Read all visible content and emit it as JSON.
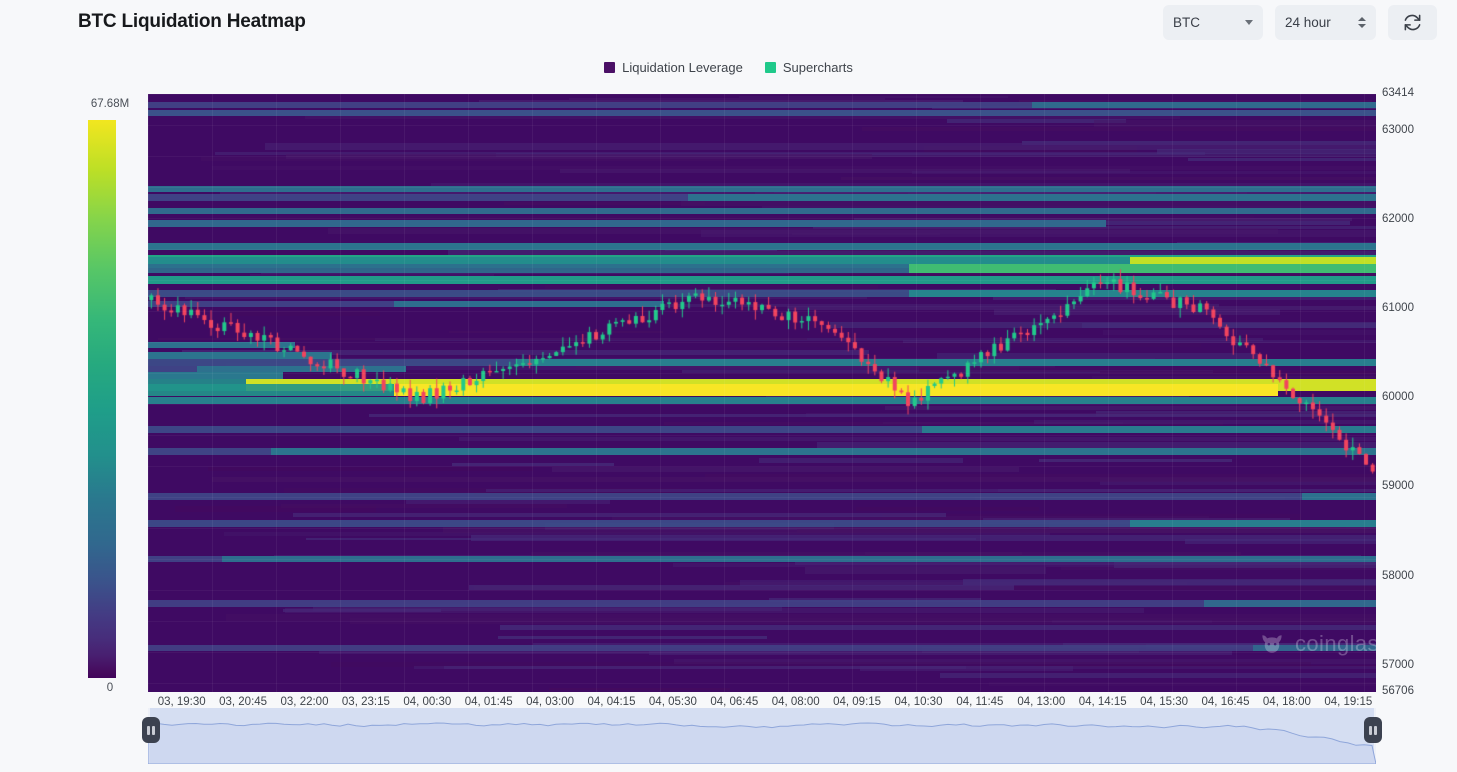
{
  "header": {
    "title": "BTC Liquidation Heatmap",
    "symbol_select": {
      "value": "BTC",
      "icon": "chevron-down-icon"
    },
    "range_stepper": {
      "value": "24 hour",
      "icon": "stepper-arrows-icon"
    },
    "refresh_button": {
      "icon": "refresh-icon",
      "label": ""
    }
  },
  "legend": [
    {
      "label": "Liquidation Leverage",
      "color": "#4b1066"
    },
    {
      "label": "Supercharts",
      "color": "#1fc98a"
    }
  ],
  "colorscale": {
    "max_label": "67.68M",
    "min_label": "0",
    "top_color": "#f2e61f",
    "bottom_color": "#42045b"
  },
  "watermark": {
    "text": "coinglass",
    "icon": "bull-logo-icon"
  },
  "brush": {
    "left_handle": "brush-handle-left",
    "right_handle": "brush-handle-right"
  },
  "chart_data": {
    "type": "heatmap",
    "title": "BTC Liquidation Heatmap",
    "xlabel": "",
    "ylabel": "",
    "grid": true,
    "legend_position": "top-center",
    "colorbar": {
      "label": "Liquidation Leverage",
      "min": 0,
      "max": 67680000,
      "min_label": "0",
      "max_label": "67.68M",
      "colormap": "viridis"
    },
    "ylim": [
      56706,
      63414
    ],
    "y_ticks": [
      63414,
      63000,
      62000,
      61000,
      60000,
      59000,
      58000,
      57000,
      56706
    ],
    "y_tick_labels": [
      "63414",
      "63000",
      "62000",
      "61000",
      "60000",
      "59000",
      "58000",
      "57000",
      "56706"
    ],
    "x_tick_labels": [
      "03, 19:30",
      "03, 20:45",
      "03, 22:00",
      "03, 23:15",
      "04, 00:30",
      "04, 01:45",
      "04, 03:00",
      "04, 04:15",
      "04, 05:30",
      "04, 06:45",
      "04, 08:00",
      "04, 09:15",
      "04, 10:30",
      "04, 11:45",
      "04, 13:00",
      "04, 14:15",
      "04, 15:30",
      "04, 16:45",
      "04, 18:00",
      "04, 19:15"
    ],
    "series": [
      {
        "name": "Liquidation Leverage",
        "type": "heatmap",
        "description": "Horizontal liquidation-level bands coloured by cumulative leverage magnitude (viridis: dark purple = low, yellow = high).",
        "bands": [
          {
            "price": 63290,
            "x_start": 0.72,
            "x_end": 1.0,
            "value": 14000000
          },
          {
            "price": 63200,
            "x_start": 0.0,
            "x_end": 1.0,
            "value": 6000000
          },
          {
            "price": 62350,
            "x_start": 0.0,
            "x_end": 1.0,
            "value": 15000000
          },
          {
            "price": 62250,
            "x_start": 0.44,
            "x_end": 1.0,
            "value": 16000000
          },
          {
            "price": 62100,
            "x_start": 0.0,
            "x_end": 1.0,
            "value": 14000000
          },
          {
            "price": 61960,
            "x_start": 0.0,
            "x_end": 0.78,
            "value": 13000000
          },
          {
            "price": 61700,
            "x_start": 0.0,
            "x_end": 1.0,
            "value": 17000000
          },
          {
            "price": 61560,
            "x_start": 0.0,
            "x_end": 1.0,
            "value": 34000000
          },
          {
            "price": 61520,
            "x_start": 0.8,
            "x_end": 1.0,
            "value": 60000000
          },
          {
            "price": 61460,
            "x_start": 0.62,
            "x_end": 1.0,
            "value": 42000000
          },
          {
            "price": 61330,
            "x_start": 0.0,
            "x_end": 1.0,
            "value": 30000000
          },
          {
            "price": 61180,
            "x_start": 0.62,
            "x_end": 1.0,
            "value": 22000000
          },
          {
            "price": 61060,
            "x_start": 0.2,
            "x_end": 0.42,
            "value": 15000000
          },
          {
            "price": 60600,
            "x_start": 0.0,
            "x_end": 0.12,
            "value": 16000000
          },
          {
            "price": 60480,
            "x_start": 0.0,
            "x_end": 0.15,
            "value": 17000000
          },
          {
            "price": 60400,
            "x_start": 0.3,
            "x_end": 1.0,
            "value": 20000000
          },
          {
            "price": 60330,
            "x_start": 0.04,
            "x_end": 0.21,
            "value": 16000000
          },
          {
            "price": 60260,
            "x_start": 0.0,
            "x_end": 0.11,
            "value": 18000000
          },
          {
            "price": 60150,
            "x_start": 0.08,
            "x_end": 1.0,
            "value": 62000000
          },
          {
            "price": 60090,
            "x_start": 0.2,
            "x_end": 0.92,
            "value": 67000000
          },
          {
            "price": 59980,
            "x_start": 0.0,
            "x_end": 1.0,
            "value": 21000000
          },
          {
            "price": 59650,
            "x_start": 0.63,
            "x_end": 1.0,
            "value": 19000000
          },
          {
            "price": 59400,
            "x_start": 0.1,
            "x_end": 1.0,
            "value": 17000000
          },
          {
            "price": 58900,
            "x_start": 0.94,
            "x_end": 1.0,
            "value": 16000000
          },
          {
            "price": 58600,
            "x_start": 0.8,
            "x_end": 1.0,
            "value": 20000000
          },
          {
            "price": 58200,
            "x_start": 0.06,
            "x_end": 1.0,
            "value": 15000000
          },
          {
            "price": 57700,
            "x_start": 0.86,
            "x_end": 1.0,
            "value": 13000000
          },
          {
            "price": 57200,
            "x_start": 0.9,
            "x_end": 1.0,
            "value": 12000000
          }
        ]
      },
      {
        "name": "Supercharts",
        "type": "candlestick",
        "up_color": "#22c98b",
        "down_color": "#f2445e",
        "ohlc_note": "BTC price candles overlaid on the heatmap; opens near 61100, peaks ~61300 mid-session, drops to ~59100 at the end.",
        "open_price": 61100,
        "high_price": 61350,
        "low_price": 59050,
        "close_price": 59250
      }
    ]
  }
}
